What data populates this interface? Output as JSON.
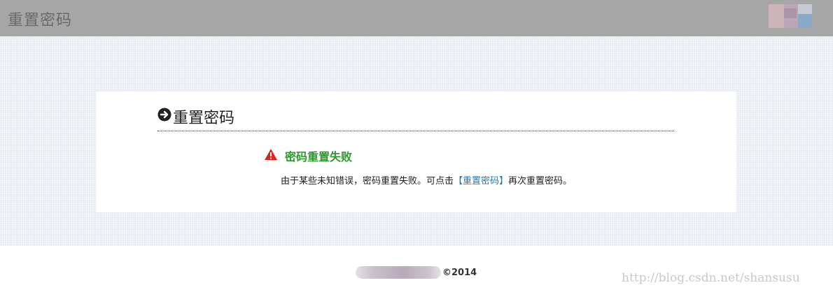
{
  "header": {
    "title": "重置密码"
  },
  "card": {
    "heading": "重置密码",
    "error_title": "密码重置失败",
    "message_before": "由于某些未知错误，密码重置失败。可点击",
    "link_text": "【重置密码】",
    "message_after": "再次重置密码。"
  },
  "footer": {
    "copyright": "©2014"
  },
  "watermark": "http://blog.csdn.net/shansusu",
  "colors": {
    "header_bg": "#a6a6a6",
    "success_green": "#2b9a2b",
    "warning_red": "#d9261c",
    "link_blue": "#2a7aa3",
    "page_bg": "#e6ecf2"
  },
  "icons": {
    "heading_icon": "arrow-right-circle-icon",
    "status_icon": "warning-triangle-icon"
  }
}
